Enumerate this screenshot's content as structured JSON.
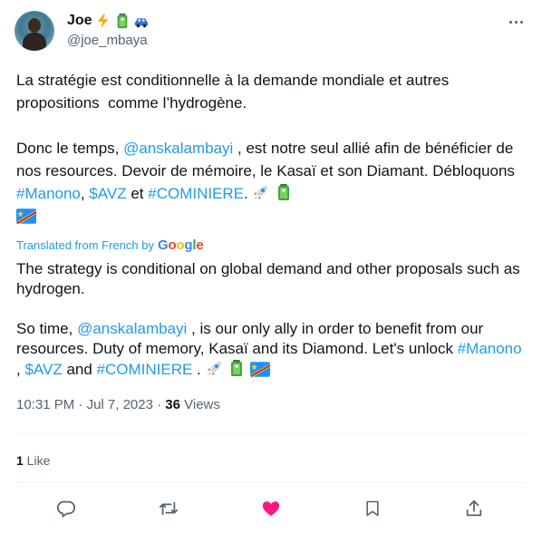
{
  "author": {
    "display_name": "Joe",
    "handle": "@joe_mbaya",
    "badges": [
      "lightning-icon",
      "battery-icon",
      "car-icon"
    ]
  },
  "tweet": {
    "original_p1": "La stratégie est conditionnelle à la demande mondiale et autres propositions  comme l’hydrogène.",
    "original_p2_before_mention": "Donc le temps, ",
    "original_mention": "@anskalambayi",
    "original_p2_after_mention": " , est notre seul allié afin de bénéficier de nos resources. Devoir de mémoire, le Kasaï et son Diamant. Débloquons ",
    "original_tag1": "#Manono",
    "original_sep1": ", ",
    "original_tag2": "$AVZ",
    "original_sep2": " et ",
    "original_tag3": "#COMINIERE",
    "original_end": ". ",
    "translated_by_label": "Translated from French by",
    "google_logo": "Google",
    "translated_p1": "The strategy is conditional on global demand and other proposals such as hydrogen.",
    "translated_p2_before_mention": "So time, ",
    "translated_mention": "@anskalambayi",
    "translated_p2_after_mention": " , is our only ally in order to benefit from our resources. Duty of memory, Kasaï and its Diamond. Let's unlock ",
    "translated_tag1": "#Manono",
    "translated_sep1": " , ",
    "translated_tag2": "$AVZ",
    "translated_sep2": " and ",
    "translated_tag3": "#COMINIERE",
    "translated_end": " . "
  },
  "meta": {
    "time": "10:31 PM",
    "sep": " · ",
    "date": "Jul 7, 2023",
    "views_count": "36",
    "views_label": " Views"
  },
  "engagement": {
    "likes_count": "1",
    "likes_label": " Like"
  },
  "colors": {
    "link": "#1d9bf0",
    "like_active": "#f91880",
    "muted": "#536471"
  },
  "actions": [
    "reply-icon",
    "retweet-icon",
    "like-icon",
    "bookmark-icon",
    "share-icon"
  ]
}
